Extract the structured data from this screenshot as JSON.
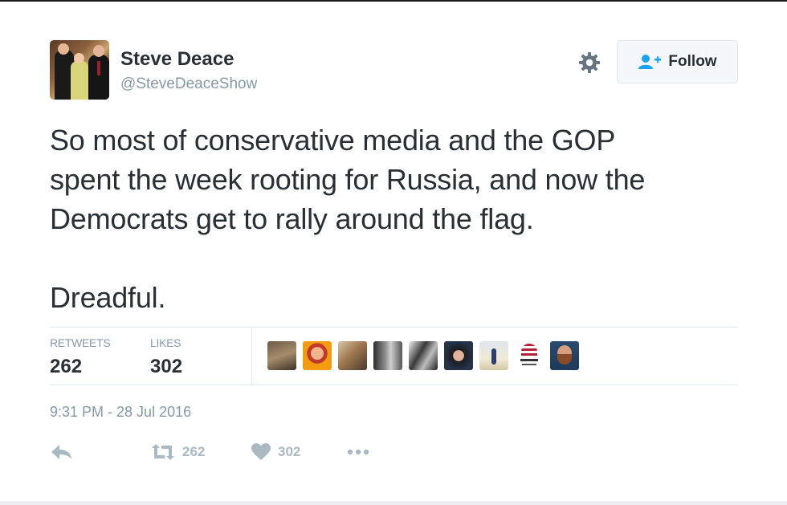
{
  "author": {
    "name": "Steve Deace",
    "handle": "@SteveDeaceShow"
  },
  "follow_button": {
    "label": "Follow"
  },
  "tweet": {
    "text": "So most of conservative media and the GOP\nspent the week rooting for Russia, and now the\nDemocrats get to rally around the flag.\n\nDreadful."
  },
  "stats": {
    "retweets_label": "RETWEETS",
    "retweets_value": "262",
    "likes_label": "LIKES",
    "likes_value": "302"
  },
  "likers": [
    "liker-avatar-1",
    "liker-avatar-2",
    "liker-avatar-3",
    "liker-avatar-4",
    "liker-avatar-5",
    "liker-avatar-6",
    "liker-avatar-7",
    "liker-avatar-8",
    "liker-avatar-9"
  ],
  "timestamp": "9:31 PM - 28 Jul 2016",
  "actions": {
    "reply_icon": "reply-icon",
    "retweet_icon": "retweet-icon",
    "retweet_count": "262",
    "like_icon": "heart-icon",
    "like_count": "302",
    "more_icon": "more-icon"
  },
  "colors": {
    "text": "#292f33",
    "muted": "#8899a6",
    "action": "#aab8c2",
    "follow_icon": "#1da1f2"
  }
}
